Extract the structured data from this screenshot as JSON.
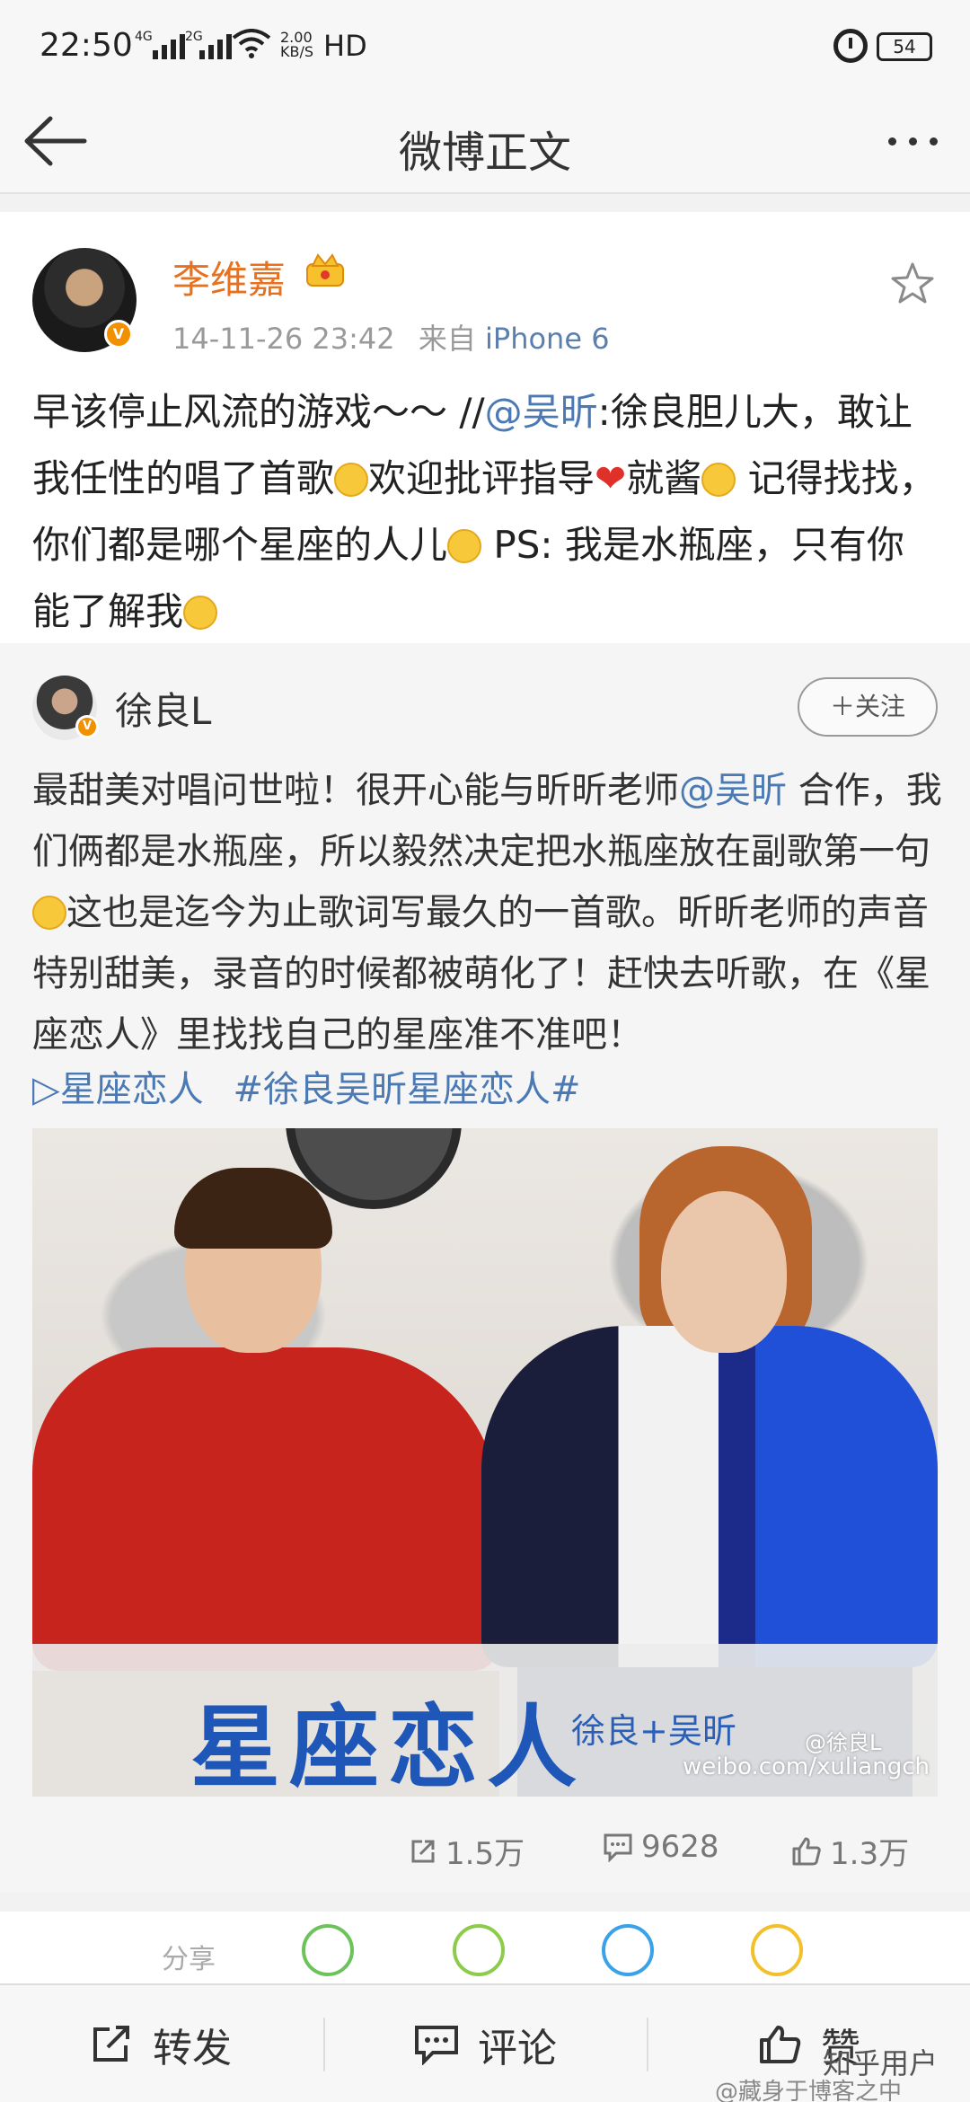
{
  "status": {
    "time": "22:50",
    "net1": "4G",
    "net2": "2G",
    "speed_value": "2.00",
    "speed_unit": "KB/S",
    "hd": "HD",
    "battery": "54"
  },
  "nav": {
    "title": "微博正文"
  },
  "post": {
    "author": "李维嘉",
    "time": "14-11-26 23:42",
    "source_prefix": "来自",
    "source": "iPhone 6",
    "text_1": "早该停止风流的游戏～～ //",
    "mention": "@吴昕",
    "text_2": ":徐良胆儿大，敢让我任性的唱了首歌",
    "text_3": "欢迎批评指导",
    "heart": "❤",
    "text_4": "就酱",
    "text_5": " 记得找找，你们都是哪个星座的人儿",
    "text_6": " PS: 我是水瓶座，只有你能了解我"
  },
  "repost": {
    "author": "徐良L",
    "follow_label": "＋关注",
    "text_1": "最甜美对唱问世啦！很开心能与昕昕老师",
    "mention": "@吴昕",
    "text_2": " 合作，我们俩都是水瓶座，所以毅然决定把水瓶座放在副歌第一句",
    "text_3": "这也是迄今为止歌词写最久的一首歌。昕昕老师的声音特别甜美，录音的时候都被萌化了！赶快去听歌，在《星座恋人》里找找自己的星座准不准吧！",
    "song_link": "▷星座恋人",
    "topic": "#徐良吴昕星座恋人#",
    "album_title": "星座恋人",
    "album_artists": "徐良+吴昕",
    "watermark_user": "@徐良L",
    "watermark_url": "weibo.com/xuliangch",
    "reposts": "1.5万",
    "comments": "9628",
    "likes": "1.3万"
  },
  "lower": {
    "label": "分享"
  },
  "toolbar": {
    "repost_label": "转发",
    "comment_label": "评论",
    "like_label": "赞",
    "watermark_1": "知乎用户",
    "watermark_2": "@藏身于博客之中"
  },
  "colors": {
    "author_orange": "#e8711f",
    "link_blue": "#4a79b4",
    "verified_orange": "#f29100"
  }
}
